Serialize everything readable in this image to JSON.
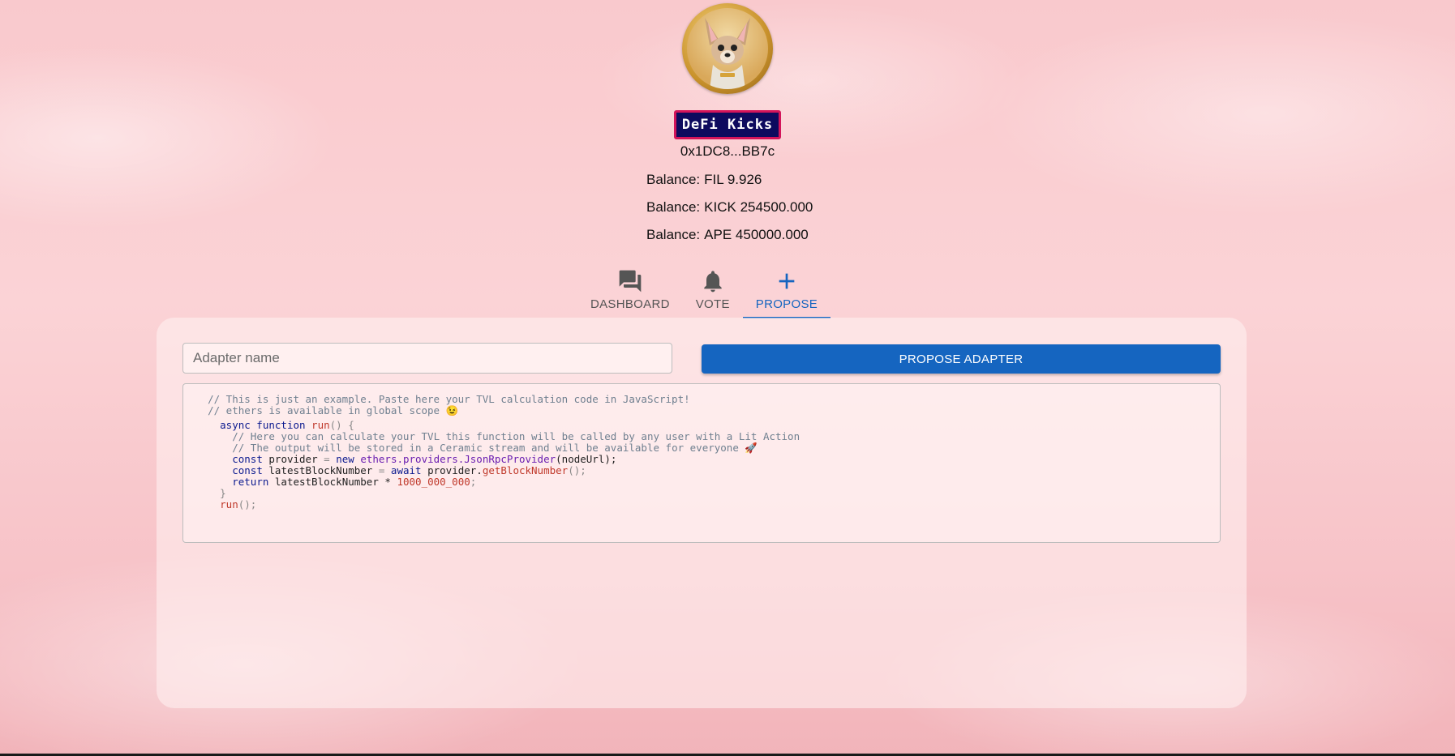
{
  "header": {
    "brand": "DeFi Kicks",
    "address": "0x1DC8...BB7c",
    "balances": [
      {
        "label": "Balance:",
        "value": "FIL 9.926"
      },
      {
        "label": "Balance:",
        "value": "KICK 254500.000"
      },
      {
        "label": "Balance:",
        "value": "APE 450000.000"
      }
    ]
  },
  "tabs": [
    {
      "label": "DASHBOARD",
      "icon": "forum-icon",
      "active": false
    },
    {
      "label": "VOTE",
      "icon": "bell-icon",
      "active": false
    },
    {
      "label": "PROPOSE",
      "icon": "plus-icon",
      "active": true
    }
  ],
  "form": {
    "name_placeholder": "Adapter name",
    "name_value": "",
    "submit_label": "PROPOSE ADAPTER"
  },
  "code": {
    "comment1": "// This is just an example. Paste here your TVL calculation code in JavaScript!",
    "comment2": "// ethers is available in global scope 😉",
    "kw_async_function": "async function",
    "fn_run": "run",
    "paren_open": "() {",
    "comment3": "// Here you can calculate your TVL this function will be called by any user with a Lit Action",
    "comment4": "// The output will be stored in a Ceramic stream and will be available for everyone 🚀",
    "kw_const": "const",
    "provider_var": "provider",
    "eq": "=",
    "kw_new": "new",
    "providers_path": "ethers.providers.",
    "cls_provider": "JsonRpcProvider",
    "provider_args": "(nodeUrl);",
    "latest_var": "latestBlockNumber",
    "kw_await": "await",
    "provider_dot": "provider.",
    "fn_getblock": "getBlockNumber",
    "empty_call": "();",
    "kw_return": "return",
    "return_expr": "latestBlockNumber *",
    "num_multiplier": "1000_000_000",
    "semicolon": ";",
    "close_brace": "}",
    "run_call_fn": "run",
    "run_call_tail": "();"
  },
  "colors": {
    "accent": "#1565c0",
    "badge_bg": "#0d0a5e",
    "badge_border": "#d3145a",
    "background": "#f9c9cd"
  }
}
